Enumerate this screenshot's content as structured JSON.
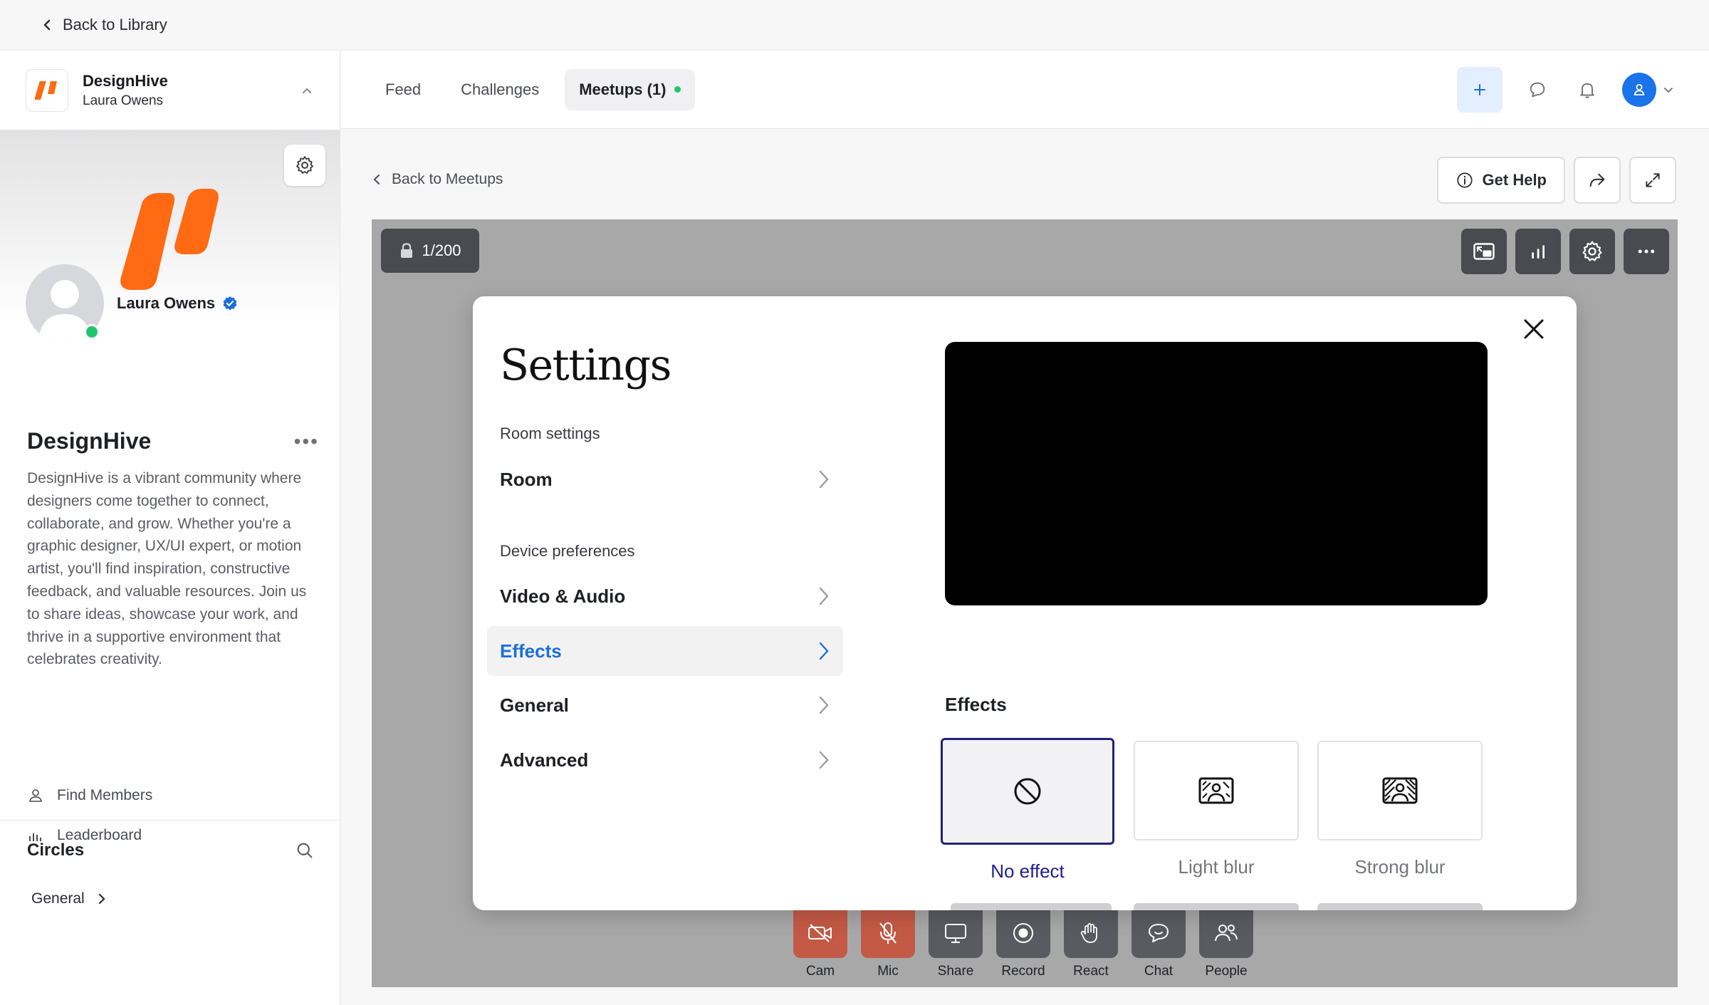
{
  "library_bar": {
    "back_label": "Back to Library"
  },
  "sidebar": {
    "community_name": "DesignHive",
    "user_name": "Laura Owens",
    "profile_name": "Laura Owens",
    "about_title": "DesignHive",
    "about_text": "DesignHive is a vibrant community where designers come together to connect, collaborate, and grow. Whether you're a graphic designer, UX/UI expert, or motion artist, you'll find inspiration, constructive feedback, and valuable resources. Join us to share ideas, showcase your work, and thrive in a supportive environment that celebrates creativity.",
    "links": [
      {
        "label": "Find Members",
        "icon": "person-icon"
      },
      {
        "label": "Leaderboard",
        "icon": "bar-chart-icon"
      }
    ],
    "circles_title": "Circles",
    "circles": [
      {
        "label": "General"
      }
    ],
    "brand_color": "#ff6a13"
  },
  "topnav": {
    "tabs": [
      {
        "label": "Feed",
        "active": false
      },
      {
        "label": "Challenges",
        "active": false
      },
      {
        "label": "Meetups (1)",
        "active": true
      }
    ]
  },
  "meetup": {
    "back_label": "Back to Meetups",
    "help_label": "Get Help",
    "seat_count": "1/200",
    "controls": [
      {
        "label": "Cam",
        "icon": "camera-off-icon",
        "state": "off"
      },
      {
        "label": "Mic",
        "icon": "mic-off-icon",
        "state": "off"
      },
      {
        "label": "Share",
        "icon": "screen-share-icon",
        "state": "on"
      },
      {
        "label": "Record",
        "icon": "record-icon",
        "state": "on"
      },
      {
        "label": "React",
        "icon": "wave-hand-icon",
        "state": "on"
      },
      {
        "label": "Chat",
        "icon": "chat-icon",
        "state": "on"
      },
      {
        "label": "People",
        "icon": "people-icon",
        "state": "on"
      }
    ]
  },
  "settings": {
    "title": "Settings",
    "sections": [
      {
        "heading": "Room settings",
        "items": [
          {
            "label": "Room",
            "active": false
          }
        ]
      },
      {
        "heading": "Device preferences",
        "items": [
          {
            "label": "Video & Audio",
            "active": false
          },
          {
            "label": "Effects",
            "active": true
          },
          {
            "label": "General",
            "active": false
          },
          {
            "label": "Advanced",
            "active": false
          }
        ]
      }
    ],
    "effects_title": "Effects",
    "effects": [
      {
        "label": "No effect",
        "icon": "no-effect-icon",
        "selected": true
      },
      {
        "label": "Light blur",
        "icon": "light-blur-icon",
        "selected": false
      },
      {
        "label": "Strong blur",
        "icon": "strong-blur-icon",
        "selected": false
      }
    ]
  }
}
